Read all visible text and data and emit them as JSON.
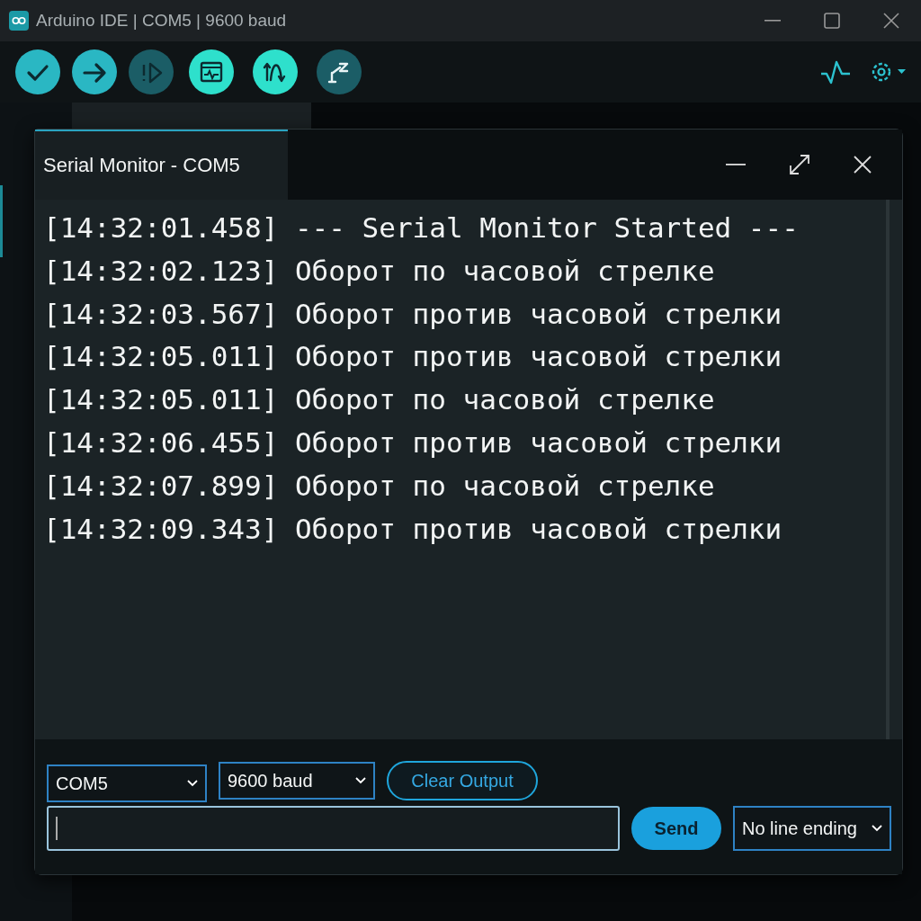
{
  "window": {
    "title": "Arduino IDE | COM5 | 9600 baud"
  },
  "toolbar": {
    "buttons": [
      {
        "kind": "verify",
        "highlighted": false,
        "disabled": false
      },
      {
        "kind": "upload",
        "highlighted": false,
        "disabled": false
      },
      {
        "kind": "debug",
        "highlighted": false,
        "disabled": true
      },
      {
        "kind": "monitor",
        "highlighted": true,
        "disabled": false
      },
      {
        "kind": "plotter",
        "highlighted": true,
        "disabled": false
      },
      {
        "kind": "tool",
        "highlighted": false,
        "disabled": true
      }
    ]
  },
  "serial_monitor": {
    "title": "Serial Monitor - COM5",
    "lines": [
      "[14:32:01.458] --- Serial Monitor Started ---",
      "[14:32:02.123] Оборот по часовой стрелке",
      "[14:32:03.567] Оборот против часовой стрелки",
      "[14:32:05.011] Оборот против часовой стрелки",
      "[14:32:05.011] Оборот по часовой стрелке",
      "[14:32:06.455] Оборот против часовой стрелки",
      "[14:32:07.899] Оборот по часовой стрелке",
      "[14:32:09.343] Оборот против часовой стрелки"
    ],
    "port": "COM5",
    "baud": "9600 baud",
    "clear_button": "Clear Output",
    "send_button": "Send",
    "line_ending": "No line ending"
  }
}
